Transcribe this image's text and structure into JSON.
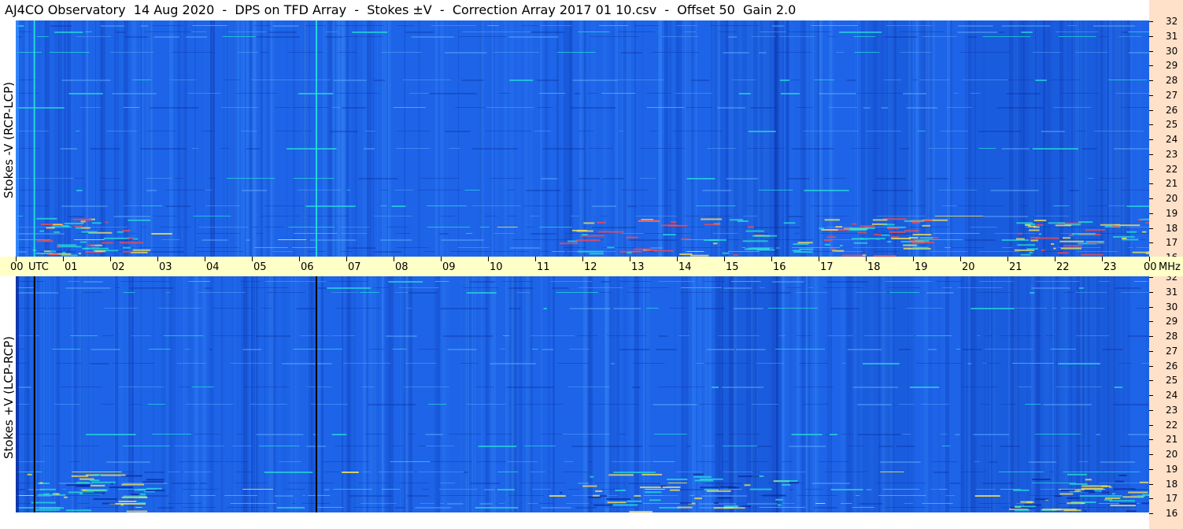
{
  "title": "AJ4CO Observatory  14 Aug 2020  -  DPS on TFD Array  -  Stokes ±V  -  Correction Array 2017 01 10.csv  -  Offset 50  Gain 2.0",
  "panels": [
    {
      "ylabel": "Stokes -V (RCP-LCP)"
    },
    {
      "ylabel": "Stokes +V (LCP-RCP)"
    }
  ],
  "chart_data": {
    "type": "heatmap",
    "title": "AJ4CO Observatory  14 Aug 2020  -  DPS on TFD Array  -  Stokes ±V  -  Correction Array 2017 01 10.csv  -  Offset 50  Gain 2.0",
    "x_axis": {
      "label": "UTC",
      "range_hours": [
        0,
        24
      ],
      "tick_labels": [
        "00",
        "01",
        "02",
        "03",
        "04",
        "05",
        "06",
        "07",
        "08",
        "09",
        "10",
        "11",
        "12",
        "13",
        "14",
        "15",
        "16",
        "17",
        "18",
        "19",
        "20",
        "21",
        "22",
        "23",
        "00"
      ]
    },
    "y_axis": {
      "unit": "MHz",
      "range": [
        16,
        32
      ],
      "tick_labels": [
        "32",
        "31",
        "30",
        "29",
        "28",
        "27",
        "26",
        "25",
        "24",
        "23",
        "22",
        "21",
        "20",
        "19",
        "18",
        "17",
        "16"
      ]
    },
    "series": [
      {
        "name": "Stokes -V (RCP-LCP)"
      },
      {
        "name": "Stokes +V (LCP-RCP)"
      }
    ],
    "vertical_lines_utc": [
      0.38,
      6.35
    ],
    "colors": {
      "background": "#1d64e8",
      "bright": "#27e0d8",
      "dark": "#0b2a9e",
      "hot": "#ffe850"
    }
  },
  "axis_text": {
    "utc_label": "UTC",
    "mhz_label": "MHz"
  }
}
